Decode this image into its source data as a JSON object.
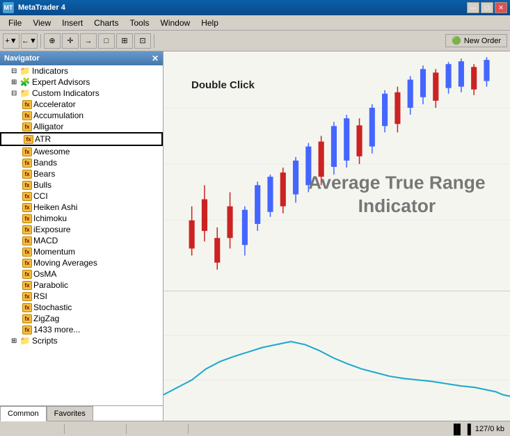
{
  "app": {
    "title": "MetaTrader 4",
    "icon": "MT"
  },
  "titlebar": {
    "minimize": "—",
    "maximize": "□",
    "close": "✕"
  },
  "menu": {
    "items": [
      "File",
      "View",
      "Insert",
      "Charts",
      "Tools",
      "Window",
      "Help"
    ]
  },
  "toolbar": {
    "new_order": "New Order",
    "buttons": [
      "+▼",
      "←▼",
      "⊕",
      "✛",
      "→",
      "□",
      "⊞",
      "⊡"
    ]
  },
  "navigator": {
    "title": "Navigator",
    "tree": {
      "indicators": {
        "label": "Indicators",
        "expanded": true
      },
      "expert_advisors": {
        "label": "Expert Advisors"
      },
      "custom_indicators": {
        "label": "Custom Indicators",
        "expanded": true,
        "children": [
          "Accelerator",
          "Accumulation",
          "Alligator",
          "ATR",
          "Awesome",
          "Bands",
          "Bears",
          "Bulls",
          "CCI",
          "Heiken Ashi",
          "Ichimoku",
          "iExposure",
          "MACD",
          "Momentum",
          "Moving Averages",
          "OsMA",
          "Parabolic",
          "RSI",
          "Stochastic",
          "ZigZag",
          "1433 more..."
        ]
      },
      "scripts": {
        "label": "Scripts"
      }
    },
    "tabs": [
      "Common",
      "Favorites"
    ],
    "active_tab": "Common"
  },
  "chart": {
    "double_click_label": "Double Click",
    "atr_label": "Average True Range\nIndicator",
    "candles": {
      "colors": {
        "bull": "#4466ff",
        "bear": "#dd2222"
      }
    }
  },
  "statusbar": {
    "panels": [
      "",
      "",
      "",
      "",
      ""
    ],
    "memory": "127/0 kb",
    "chart_icon": "▐▌▐"
  }
}
